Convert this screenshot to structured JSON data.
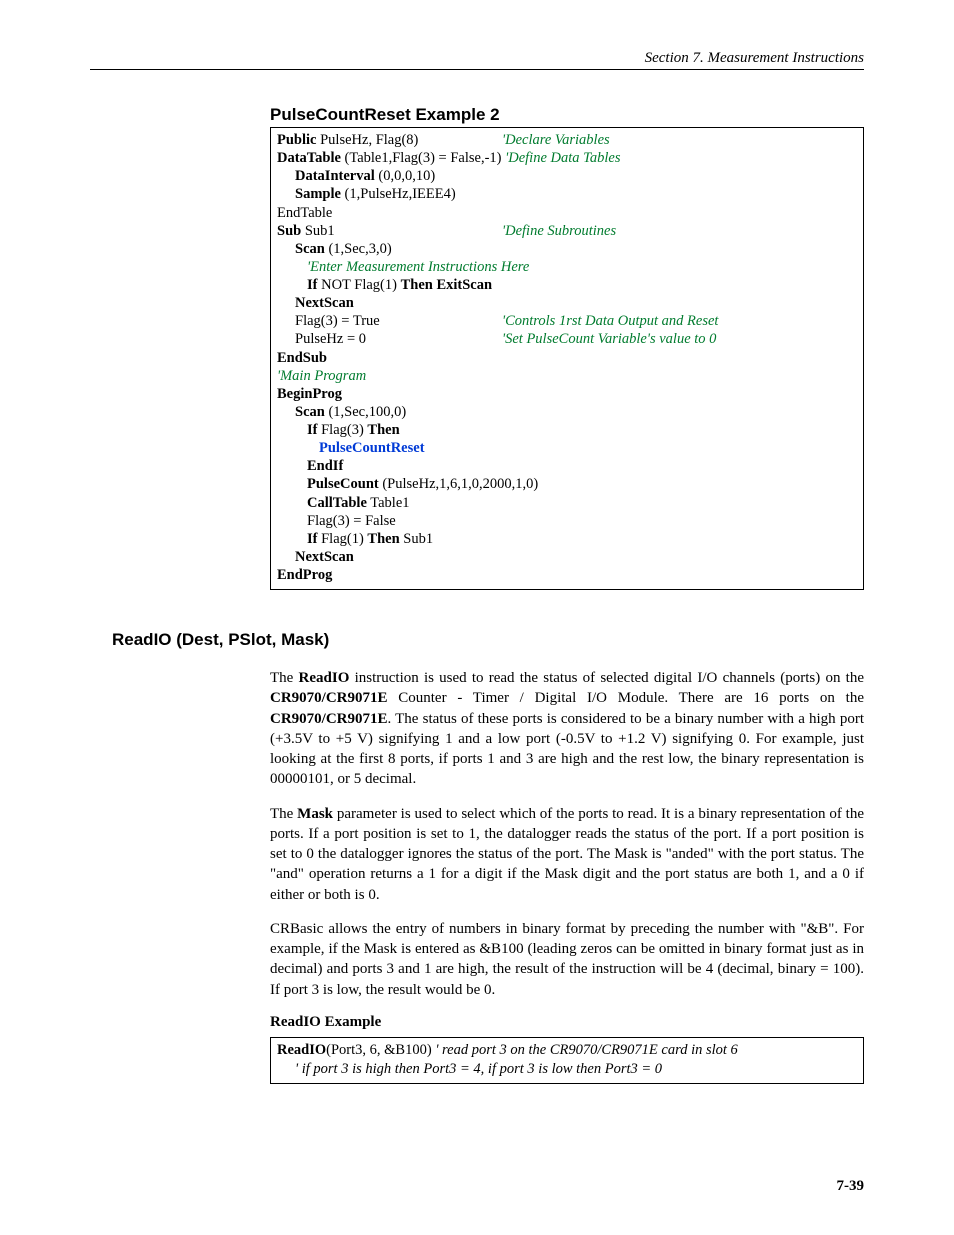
{
  "header": "Section 7.  Measurement Instructions",
  "example_title": "PulseCountReset Example 2",
  "code": {
    "l1a": "Public",
    "l1b": " PulseHz, Flag(8)",
    "l1c": "'Declare Variables",
    "l2a": "DataTable",
    "l2b": " (Table1,Flag(3) = False,-1)",
    "l2c": " 'Define Data Tables",
    "l3a": "DataInterval",
    "l3b": " (0,0,0,10)",
    "l4a": "Sample",
    "l4b": " (1,PulseHz,IEEE4)",
    "l5": "EndTable",
    "l6a": "Sub",
    "l6b": "  Sub1",
    "l6c": "'Define Subroutines",
    "l7a": "Scan",
    "l7b": " (1,Sec,3,0)",
    "l8": "'Enter Measurement Instructions Here",
    "l9a": "If",
    "l9b": "  NOT Flag(1) ",
    "l9c": "Then ExitScan",
    "l10": "NextScan",
    "l11a": "Flag(3) = True",
    "l11b": "'Controls 1rst Data Output and Reset",
    "l12a": "PulseHz = 0",
    "l12b": "'Set PulseCount Variable's value to 0",
    "l13": "EndSub",
    "l14": "'Main Program",
    "l15": "BeginProg",
    "l16a": "Scan",
    "l16b": " (1,Sec,100,0)",
    "l17a": "If",
    "l17b": " Flag(3) ",
    "l17c": "Then",
    "l18": "PulseCountReset",
    "l19": "EndIf",
    "l20a": "PulseCount",
    "l20b": " (PulseHz,1,6,1,0,2000,1,0)",
    "l21a": "CallTable",
    "l21b": " Table1",
    "l22": "Flag(3) = False",
    "l23a": "If",
    "l23b": " Flag(1)   ",
    "l23c": "Then",
    "l23d": " Sub1",
    "l24": "NextScan",
    "l25": "EndProg"
  },
  "section_head": "ReadIO (Dest, PSlot, Mask)",
  "para1_pre": "The ",
  "para1_b1": "ReadIO",
  "para1_mid1": " instruction is used to read the status of selected digital I/O channels (ports) on the ",
  "para1_b2": "CR9070/CR9071E",
  "para1_mid2": " Counter - Timer / Digital I/O Module.  There are 16 ports on the ",
  "para1_b3": "CR9070/CR9071E",
  "para1_post": ".  The status of these ports is considered to be a binary number with a high port (+3.5V to +5 V) signifying 1 and a low port (-0.5V to +1.2 V) signifying 0. For example, just looking at the first 8 ports, if ports 1 and 3 are high and the rest low, the binary representation is 00000101, or 5 decimal.",
  "para2_pre": "The ",
  "para2_b1": "Mask",
  "para2_post": " parameter is used to select which of the ports to read. It is a binary representation of the ports. If a port position is set to 1, the datalogger reads the status of the port. If a port position is set to 0 the datalogger ignores the status of the port. The Mask is \"anded\" with the port status. The \"and\" operation returns a 1 for a digit if the Mask digit and the port status are both 1, and a 0 if either or both is 0.",
  "para3": "CRBasic allows the entry of numbers in binary format by preceding the number with \"&B\". For example, if the Mask is entered as &B100 (leading zeros can be omitted in binary format just as in decimal) and ports 3 and 1 are high, the result of the instruction will be 4 (decimal, binary = 100). If port 3 is low, the result would be 0.",
  "sub_head": "ReadIO Example",
  "ex2_l1_b": "ReadIO",
  "ex2_l1_args": "(Port3, 6, &B100) ",
  "ex2_l1_c": "' read port 3 on the CR9070/CR9071E card in slot 6",
  "ex2_l2": "' if port 3 is high then Port3 = 4, if port 3 is low then Port3 = 0",
  "page_num": "7-39"
}
